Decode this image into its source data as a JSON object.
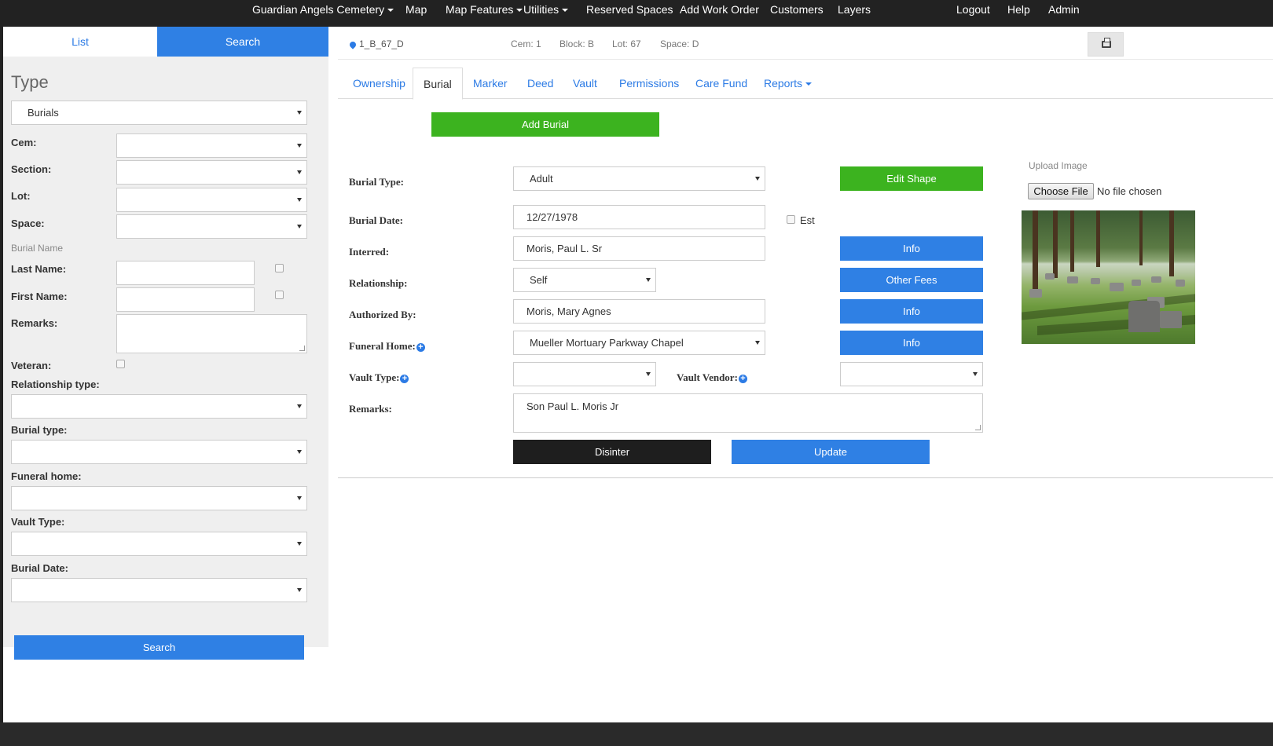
{
  "topnav": {
    "cemetery": "Guardian Angels Cemetery",
    "map": "Map",
    "map_features": "Map Features",
    "utilities": "Utilities",
    "reserved_spaces": "Reserved Spaces",
    "add_work_order": "Add Work Order",
    "customers": "Customers",
    "layers": "Layers",
    "logout": "Logout",
    "help": "Help",
    "admin": "Admin"
  },
  "sidebar": {
    "tabs": {
      "list": "List",
      "search": "Search"
    },
    "type_heading": "Type",
    "type_value": "Burials",
    "labels": {
      "cem": "Cem:",
      "section": "Section:",
      "lot": "Lot:",
      "space": "Space:",
      "burial_name": "Burial Name",
      "last_name": "Last Name:",
      "first_name": "First Name:",
      "remarks": "Remarks:",
      "veteran": "Veteran:",
      "relationship_type": "Relationship type:",
      "burial_type": "Burial type:",
      "funeral_home": "Funeral home:",
      "vault_type": "Vault Type:",
      "burial_date": "Burial Date:"
    },
    "search_button": "Search"
  },
  "infobar": {
    "location": "1_B_67_D",
    "cem": "Cem: 1",
    "block": "Block: B",
    "lot": "Lot: 67",
    "space": "Space: D"
  },
  "tabs": [
    "Ownership",
    "Burial",
    "Marker",
    "Deed",
    "Vault",
    "Permissions",
    "Care Fund",
    "Reports"
  ],
  "burial": {
    "add_burial": "Add Burial",
    "labels": {
      "burial_type": "Burial Type:",
      "burial_date": "Burial Date:",
      "interred": "Interred:",
      "relationship": "Relationship:",
      "authorized_by": "Authorized By:",
      "funeral_home": "Funeral Home:",
      "vault_type": "Vault Type:",
      "vault_vendor": "Vault Vendor:",
      "remarks": "Remarks:"
    },
    "values": {
      "burial_type": "Adult",
      "burial_date": "12/27/1978",
      "interred": "Moris, Paul L. Sr",
      "relationship": "Self",
      "authorized_by": "Moris, Mary Agnes",
      "funeral_home": "Mueller Mortuary Parkway Chapel",
      "vault_type": "",
      "vault_vendor": "",
      "remarks": "Son Paul L. Moris Jr"
    },
    "est_label": "Est",
    "buttons": {
      "edit_shape": "Edit Shape",
      "info": "Info",
      "other_fees": "Other Fees",
      "disinter": "Disinter",
      "update": "Update"
    },
    "upload": {
      "label": "Upload Image",
      "choose_file": "Choose File",
      "no_file": "No file chosen"
    }
  },
  "colors": {
    "primary_blue": "#2f80e4",
    "green": "#3cb31f",
    "dark": "#1e1e1e",
    "nav_bg": "#222222"
  }
}
